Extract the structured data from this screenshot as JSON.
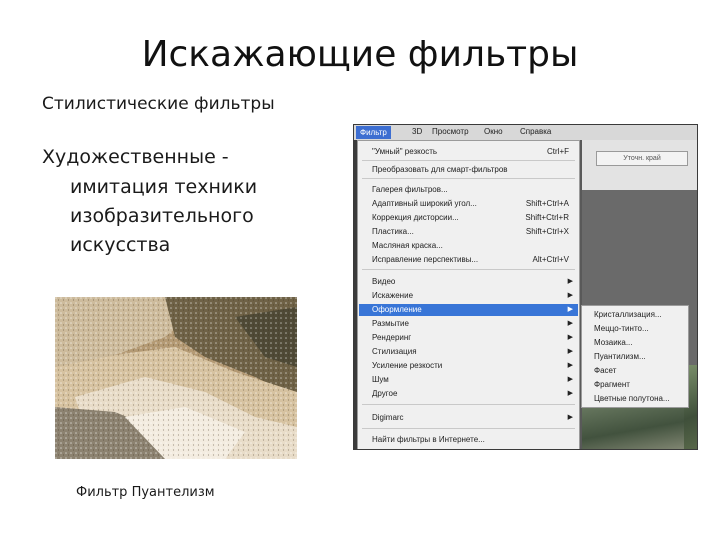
{
  "slide": {
    "title": "Искажающие фильтры",
    "subtitle": "Стилистические фильтры",
    "bullet_head": "Художественные  -",
    "bullet_lines": [
      "имитация техники",
      "изобразительного",
      "искусства"
    ],
    "caption": "Фильтр Пуантелизм"
  },
  "menubar": {
    "items": [
      "Фильтр",
      "3D",
      "Просмотр",
      "Окно",
      "Справка"
    ]
  },
  "toolbar": {
    "button_label": "Уточн. край"
  },
  "filter_menu": {
    "items": [
      {
        "label": "\"Умный\" резкость",
        "shortcut": "Ctrl+F"
      },
      {
        "label": "Преобразовать для смарт-фильтров",
        "shortcut": ""
      },
      {
        "label": "Галерея фильтров...",
        "shortcut": ""
      },
      {
        "label": "Адаптивный широкий угол...",
        "shortcut": "Shift+Ctrl+A"
      },
      {
        "label": "Коррекция дисторсии...",
        "shortcut": "Shift+Ctrl+R"
      },
      {
        "label": "Пластика...",
        "shortcut": "Shift+Ctrl+X"
      },
      {
        "label": "Масляная краска...",
        "shortcut": ""
      },
      {
        "label": "Исправление перспективы...",
        "shortcut": "Alt+Ctrl+V"
      },
      {
        "label": "Видео",
        "shortcut": ""
      },
      {
        "label": "Искажение",
        "shortcut": ""
      },
      {
        "label": "Оформление",
        "shortcut": ""
      },
      {
        "label": "Размытие",
        "shortcut": ""
      },
      {
        "label": "Рендеринг",
        "shortcut": ""
      },
      {
        "label": "Стилизация",
        "shortcut": ""
      },
      {
        "label": "Усиление резкости",
        "shortcut": ""
      },
      {
        "label": "Шум",
        "shortcut": ""
      },
      {
        "label": "Другое",
        "shortcut": ""
      },
      {
        "label": "Digimarc",
        "shortcut": ""
      },
      {
        "label": "Найти фильтры в Интернете...",
        "shortcut": ""
      }
    ]
  },
  "submenu": {
    "items": [
      "Кристаллизация...",
      "Меццо-тинто...",
      "Мозаика...",
      "Пуантилизм...",
      "Фасет",
      "Фрагмент",
      "Цветные полутона..."
    ]
  },
  "colors": {
    "highlight": "#3875d7",
    "menu_bg": "#f0f0f0"
  }
}
